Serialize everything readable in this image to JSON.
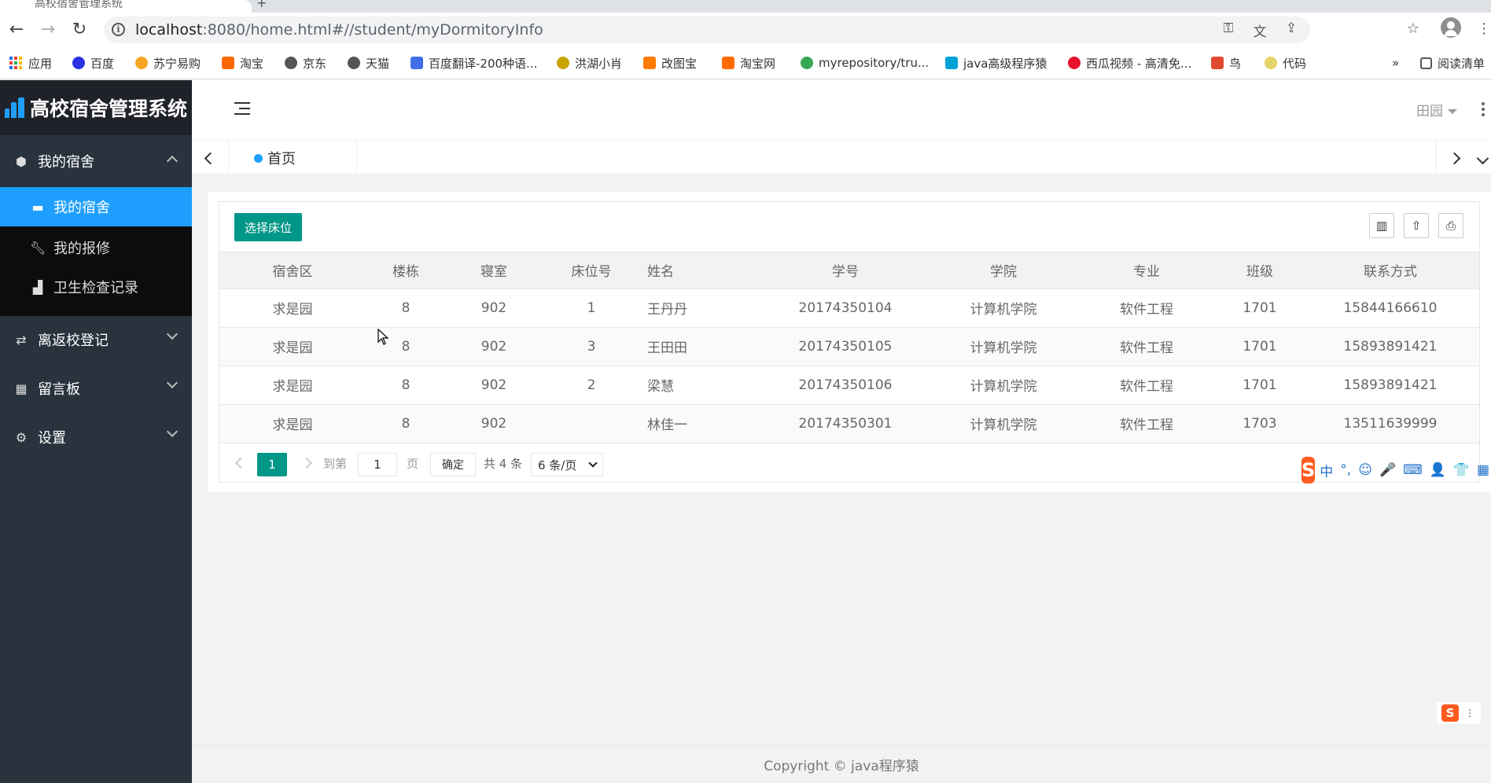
{
  "browser": {
    "tab_title": "高校宿舍管理系统",
    "url_host": "localhost",
    "url_rest": ":8080/home.html#//student/myDormitoryInfo",
    "bookmarks": [
      {
        "label": "应用",
        "color": "#1a73e8"
      },
      {
        "label": "百度",
        "color": "#2932e1"
      },
      {
        "label": "苏宁易购",
        "color": "#f5a623"
      },
      {
        "label": "淘宝",
        "color": "#ff6a00"
      },
      {
        "label": "京东",
        "color": "#555555"
      },
      {
        "label": "天猫",
        "color": "#555555"
      },
      {
        "label": "百度翻译-200种语...",
        "color": "#3f6ee8"
      },
      {
        "label": "洪湖小肖",
        "color": "#c8a400"
      },
      {
        "label": "改图宝",
        "color": "#ff7a00"
      },
      {
        "label": "淘宝网",
        "color": "#ff6a00"
      },
      {
        "label": "myrepository/tru...",
        "color": "#34a853"
      },
      {
        "label": "java高级程序猿",
        "color": "#00a1d6"
      },
      {
        "label": "西瓜视频 - 高清免...",
        "color": "#e8112d"
      },
      {
        "label": "鸟",
        "color": "#e04a2f"
      },
      {
        "label": "代码",
        "color": "#e8d36a"
      }
    ],
    "bookmarks_more": "»",
    "reading_list": "阅读清单"
  },
  "app": {
    "title": "高校宿舍管理系统",
    "accent": "#1e9fff",
    "primary": "#009688",
    "header_user": "田园"
  },
  "sidebar": {
    "groups": [
      {
        "label": "我的宿舍",
        "icon": "cube-icon",
        "glyph": "⬢"
      },
      {
        "label": "离返校登记",
        "icon": "swap-icon",
        "glyph": "⇄"
      },
      {
        "label": "留言板",
        "icon": "calendar-icon",
        "glyph": "▦"
      },
      {
        "label": "设置",
        "icon": "gear-icon",
        "glyph": "⚙"
      }
    ],
    "sub_items": [
      {
        "label": "我的宿舍",
        "icon": "bed-icon",
        "glyph": "🛏"
      },
      {
        "label": "我的报修",
        "icon": "wrench-icon",
        "glyph": "🔧"
      },
      {
        "label": "卫生检查记录",
        "icon": "bar-chart-icon",
        "glyph": "📊"
      }
    ]
  },
  "tabs": {
    "home": "首页"
  },
  "toolbar": {
    "select_bed": "选择床位"
  },
  "table": {
    "headers": [
      "宿舍区",
      "楼栋",
      "寝室",
      "床位号",
      "姓名",
      "学号",
      "学院",
      "专业",
      "班级",
      "联系方式"
    ],
    "rows": [
      [
        "求是园",
        "8",
        "902",
        "1",
        "王丹丹",
        "20174350104",
        "计算机学院",
        "软件工程",
        "1701",
        "15844166610"
      ],
      [
        "求是园",
        "8",
        "902",
        "3",
        "王田田",
        "20174350105",
        "计算机学院",
        "软件工程",
        "1701",
        "15893891421"
      ],
      [
        "求是园",
        "8",
        "902",
        "2",
        "梁慧",
        "20174350106",
        "计算机学院",
        "软件工程",
        "1701",
        "15893891421"
      ],
      [
        "求是园",
        "8",
        "902",
        "",
        "林佳一",
        "20174350301",
        "计算机学院",
        "软件工程",
        "1703",
        "13511639999"
      ]
    ]
  },
  "pager": {
    "current": "1",
    "goto_label": "到第",
    "goto_value": "1",
    "page_label": "页",
    "confirm": "确定",
    "total": "共 4 条",
    "per_page": "6 条/页"
  },
  "footer": {
    "copyright": "Copyright © java程序猿"
  },
  "ime": {
    "logo": "S",
    "items": [
      "中",
      "°,",
      "☺",
      "🎤",
      "⌨",
      "👤",
      "👕",
      "▦"
    ]
  }
}
